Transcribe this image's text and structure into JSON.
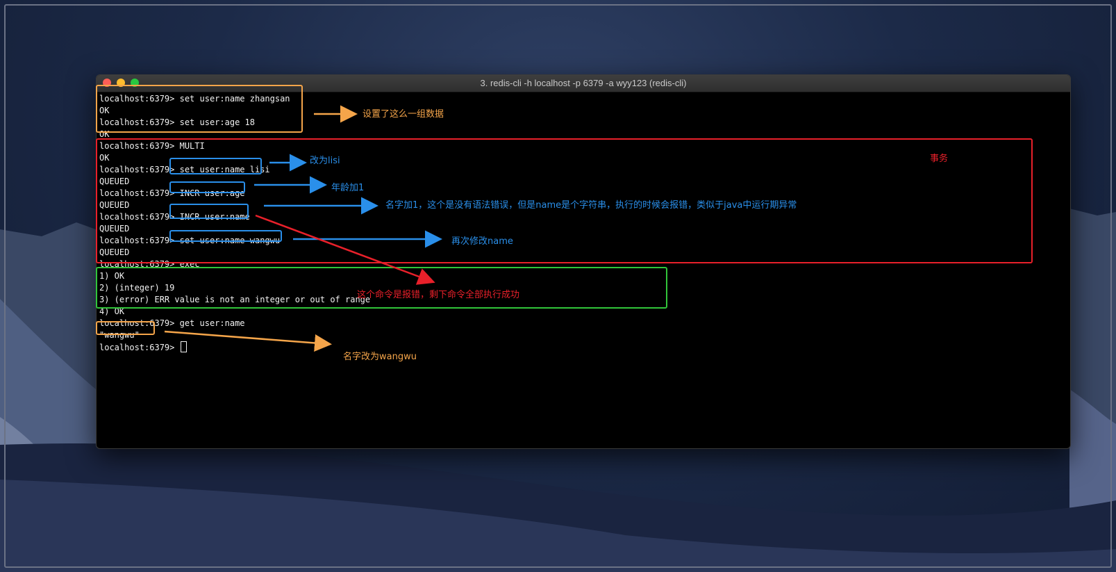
{
  "window": {
    "title": "3. redis-cli -h localhost -p 6379 -a wyy123 (redis-cli)"
  },
  "terminal": {
    "lines": [
      "localhost:6379> set user:name zhangsan",
      "OK",
      "localhost:6379> set user:age 18",
      "OK",
      "localhost:6379> MULTI",
      "OK",
      "localhost:6379> set user:name lisi",
      "QUEUED",
      "localhost:6379> INCR user:age",
      "QUEUED",
      "localhost:6379> INCR user:name",
      "QUEUED",
      "localhost:6379> set user:name wangwu",
      "QUEUED",
      "localhost:6379> exec",
      "1) OK",
      "2) (integer) 19",
      "3) (error) ERR value is not an integer or out of range",
      "4) OK",
      "localhost:6379> get user:name",
      "\"wangwu\"",
      "localhost:6379> "
    ]
  },
  "annotations": {
    "set_data": "设置了这么一组数据",
    "transaction": "事务",
    "to_lisi": "改为lisi",
    "age_plus_one": "年龄加1",
    "name_plus_one": "名字加1，这个是没有语法错误，但是name是个字符串，执行的时候会报错，类似于java中运行期异常",
    "modify_name_again": "再次修改name",
    "error_note": "这个命令是报错，剩下命令全部执行成功",
    "name_changed": "名字改为wangwu"
  },
  "colors": {
    "orange": "#f5a54a",
    "red": "#e8202a",
    "blue": "#2a8fea",
    "green": "#31c53a",
    "terminal_bg": "#000000",
    "terminal_fg": "#f2f2f2"
  }
}
